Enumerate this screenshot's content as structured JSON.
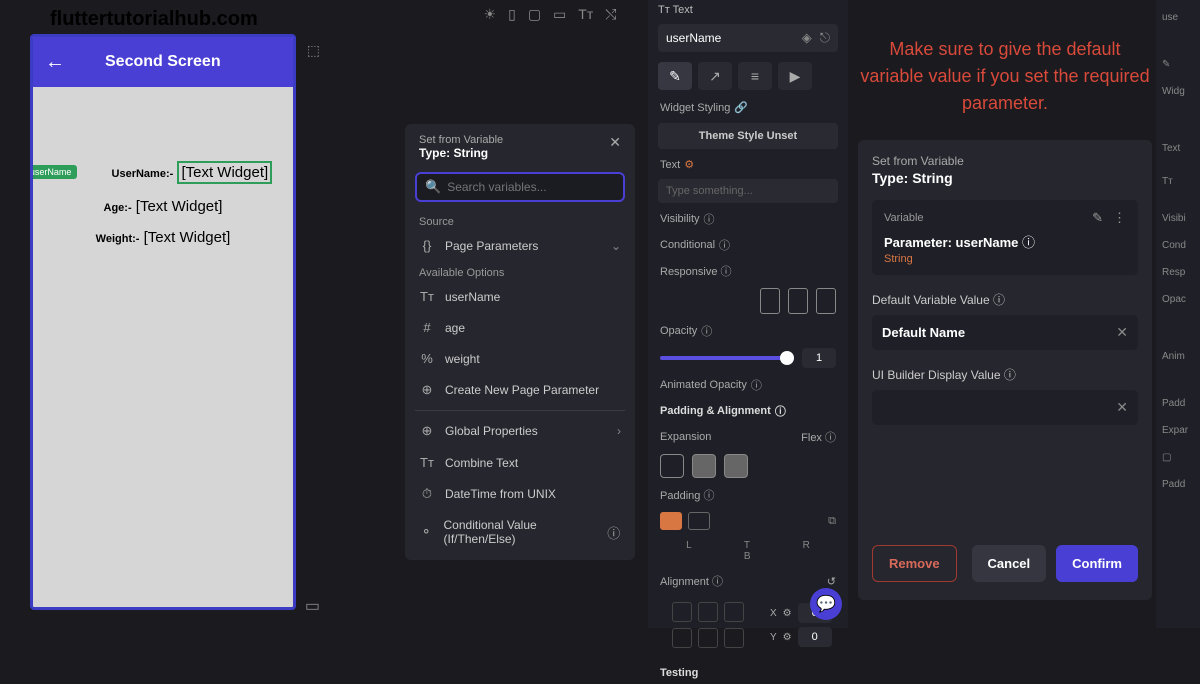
{
  "watermark": "fluttertutorialhub.com",
  "phone": {
    "appbar_title": "Second Screen",
    "tag": "userName",
    "rows": [
      {
        "label": "UserName:-",
        "value": "[Text Widget]"
      },
      {
        "label": "Age:-",
        "value": "[Text Widget]"
      },
      {
        "label": "Weight:-",
        "value": "[Text Widget]"
      }
    ]
  },
  "var_popup": {
    "set_from": "Set from Variable",
    "type_label": "Type: String",
    "search_placeholder": "Search variables...",
    "source_label": "Source",
    "page_params": "Page Parameters",
    "available_label": "Available Options",
    "options": [
      {
        "icon": "Tᴛ",
        "label": "userName"
      },
      {
        "icon": "#",
        "label": "age"
      },
      {
        "icon": "%",
        "label": "weight"
      },
      {
        "icon": "⊕",
        "label": "Create New Page Parameter"
      }
    ],
    "extras": [
      {
        "icon": "⊕",
        "label": "Global Properties",
        "chev": true
      },
      {
        "icon": "Tᴛ",
        "label": "Combine Text"
      },
      {
        "icon": "⏱",
        "label": "DateTime from UNIX"
      },
      {
        "icon": "⚬",
        "label": "Conditional Value (If/Then/Else)"
      }
    ]
  },
  "props": {
    "breadcrumb": "Tᴛ Text",
    "widget_name": "userName",
    "styling_label": "Widget Styling",
    "theme_unset": "Theme Style Unset",
    "text_label": "Text",
    "text_placeholder": "Type something...",
    "visibility": "Visibility",
    "conditional": "Conditional",
    "responsive": "Responsive",
    "opacity": "Opacity",
    "opacity_value": "1",
    "anim_opacity": "Animated Opacity",
    "pad_align": "Padding & Alignment",
    "expansion": "Expansion",
    "flex": "Flex",
    "padding": "Padding",
    "pad_letters": {
      "l": "L",
      "t": "T",
      "r": "R",
      "b": "B"
    },
    "alignment": "Alignment",
    "coords": {
      "xlabel": "X",
      "xval": "0",
      "ylabel": "Y",
      "yval": "0"
    },
    "testing": "Testing"
  },
  "warning_text": "Make sure to give the default variable value if you set the required parameter.",
  "confirm": {
    "set_from": "Set from Variable",
    "type_label": "Type: String",
    "variable_label": "Variable",
    "param_label": "Parameter: userName",
    "param_type": "String",
    "default_label": "Default Variable Value",
    "default_value": "Default Name",
    "ui_display_label": "UI Builder Display Value",
    "ui_display_value": "",
    "remove": "Remove",
    "cancel": "Cancel",
    "confirm_btn": "Confirm"
  },
  "right_strip": {
    "a": "use",
    "b": "Widg",
    "c": "Text",
    "d": "Visibi",
    "e": "Cond",
    "f": "Resp",
    "g": "Opac",
    "h": "Anim",
    "i": "Padd",
    "j": "Expar",
    "k": "Padd"
  }
}
